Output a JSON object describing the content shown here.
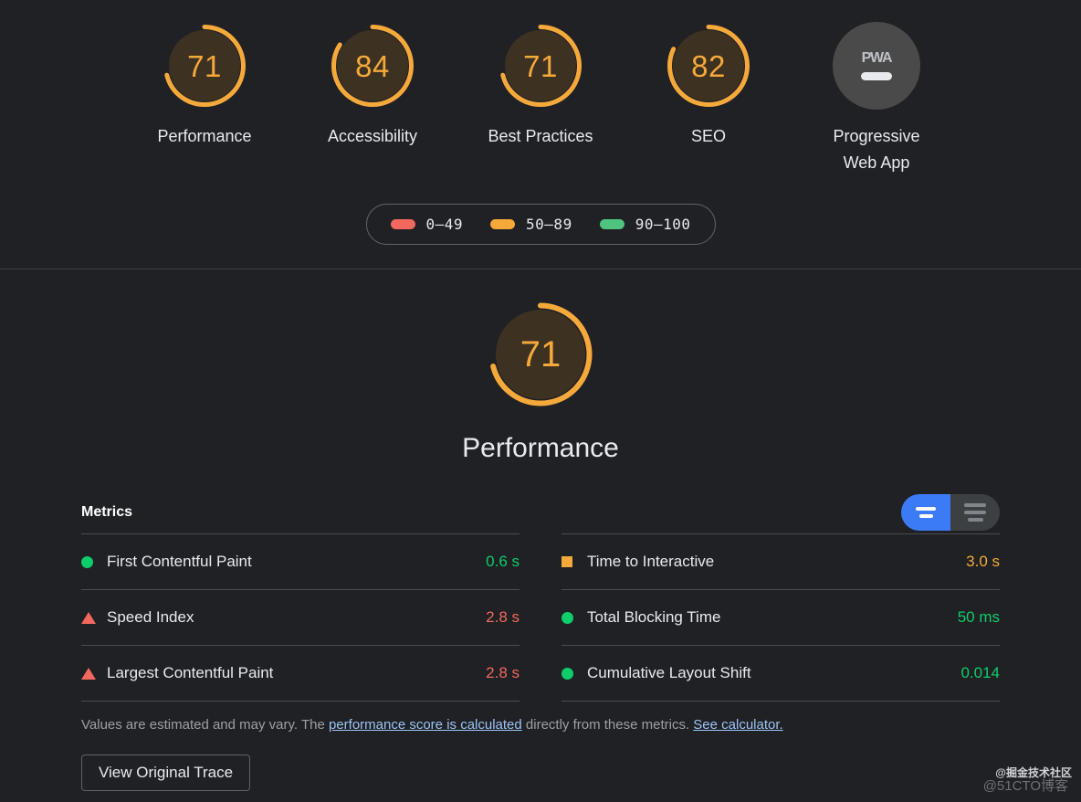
{
  "colors": {
    "background": "#202124",
    "orange": "#f5a93a",
    "green": "#0cce6b",
    "red": "#f2685d",
    "gauge_fill_orange": "#3d3122",
    "blue_active": "#3b7cf6",
    "link": "#9cc3f5"
  },
  "top_scores": {
    "gauges": [
      {
        "score": "71",
        "label": "Performance",
        "rating": "average"
      },
      {
        "score": "84",
        "label": "Accessibility",
        "rating": "average"
      },
      {
        "score": "71",
        "label": "Best Practices",
        "rating": "average"
      },
      {
        "score": "82",
        "label": "SEO",
        "rating": "average"
      }
    ],
    "pwa": {
      "badge_text": "PWA",
      "label": "Progressive Web App"
    },
    "legend": [
      {
        "swatch_color": "#f2685d",
        "range": "0–49"
      },
      {
        "swatch_color": "#f5a93a",
        "range": "50–89"
      },
      {
        "swatch_color": "#4ec47f",
        "range": "90–100"
      }
    ]
  },
  "category": {
    "score": "71",
    "title": "Performance"
  },
  "metrics": {
    "heading": "Metrics",
    "toggle": {
      "simple_view_label": "simple-view-toggle",
      "expanded_view_label": "expanded-view-toggle",
      "active": "simple"
    },
    "left_column": [
      {
        "icon": "circle",
        "icon_color": "#0cce6b",
        "name": "First Contentful Paint",
        "value": "0.6 s",
        "value_color": "#0cce6b"
      },
      {
        "icon": "triangle",
        "icon_color": "#f2685d",
        "name": "Speed Index",
        "value": "2.8 s",
        "value_color": "#f2685d"
      },
      {
        "icon": "triangle",
        "icon_color": "#f2685d",
        "name": "Largest Contentful Paint",
        "value": "2.8 s",
        "value_color": "#f2685d"
      }
    ],
    "right_column": [
      {
        "icon": "square",
        "icon_color": "#f5a93a",
        "name": "Time to Interactive",
        "value": "3.0 s",
        "value_color": "#f5a93a"
      },
      {
        "icon": "circle",
        "icon_color": "#0cce6b",
        "name": "Total Blocking Time",
        "value": "50 ms",
        "value_color": "#0cce6b"
      },
      {
        "icon": "circle",
        "icon_color": "#0cce6b",
        "name": "Cumulative Layout Shift",
        "value": "0.014",
        "value_color": "#0cce6b"
      }
    ],
    "note": {
      "part1": "Values are estimated and may vary. The ",
      "link1": "performance score is calculated",
      "part2": " directly from these metrics. ",
      "link2": "See calculator."
    },
    "trace_button": "View Original Trace"
  },
  "watermarks": {
    "primary": "@掘金技术社区",
    "secondary": "@51CTO博客"
  }
}
